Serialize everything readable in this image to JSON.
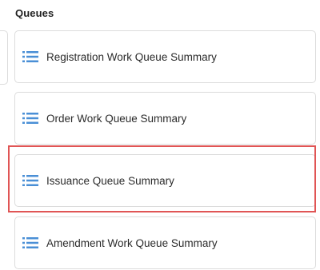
{
  "section": {
    "title": "Queues"
  },
  "queues": [
    {
      "label": "Registration Work Queue Summary",
      "icon": "list-icon"
    },
    {
      "label": "Order Work Queue Summary",
      "icon": "list-icon"
    },
    {
      "label": "Issuance Queue Summary",
      "icon": "list-icon",
      "highlighted": true
    },
    {
      "label": "Amendment Work Queue Summary",
      "icon": "list-icon"
    }
  ],
  "colors": {
    "icon": "#4a8fd6",
    "highlight_border": "#e05555",
    "card_border": "#dcdcdc"
  }
}
